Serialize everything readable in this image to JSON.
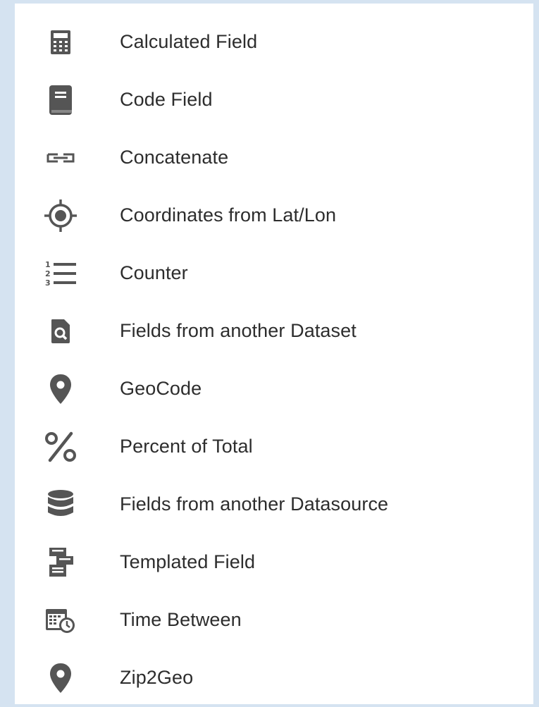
{
  "menu": {
    "items": [
      {
        "label": "Calculated Field",
        "icon": "calculator-icon"
      },
      {
        "label": "Code Field",
        "icon": "book-icon"
      },
      {
        "label": "Concatenate",
        "icon": "link-icon"
      },
      {
        "label": "Coordinates from Lat/Lon",
        "icon": "crosshair-icon"
      },
      {
        "label": "Counter",
        "icon": "numbered-list-icon"
      },
      {
        "label": "Fields from another Dataset",
        "icon": "file-search-icon"
      },
      {
        "label": "GeoCode",
        "icon": "map-pin-icon"
      },
      {
        "label": "Percent of Total",
        "icon": "percent-icon"
      },
      {
        "label": "Fields from another Datasource",
        "icon": "database-icon"
      },
      {
        "label": "Templated Field",
        "icon": "template-icon"
      },
      {
        "label": "Time Between",
        "icon": "calendar-clock-icon"
      },
      {
        "label": "Zip2Geo",
        "icon": "map-pin-icon"
      }
    ]
  },
  "colors": {
    "icon": "#555555",
    "text": "#2d2d2d",
    "page_background": "#d5e3f1",
    "menu_background": "#ffffff"
  }
}
